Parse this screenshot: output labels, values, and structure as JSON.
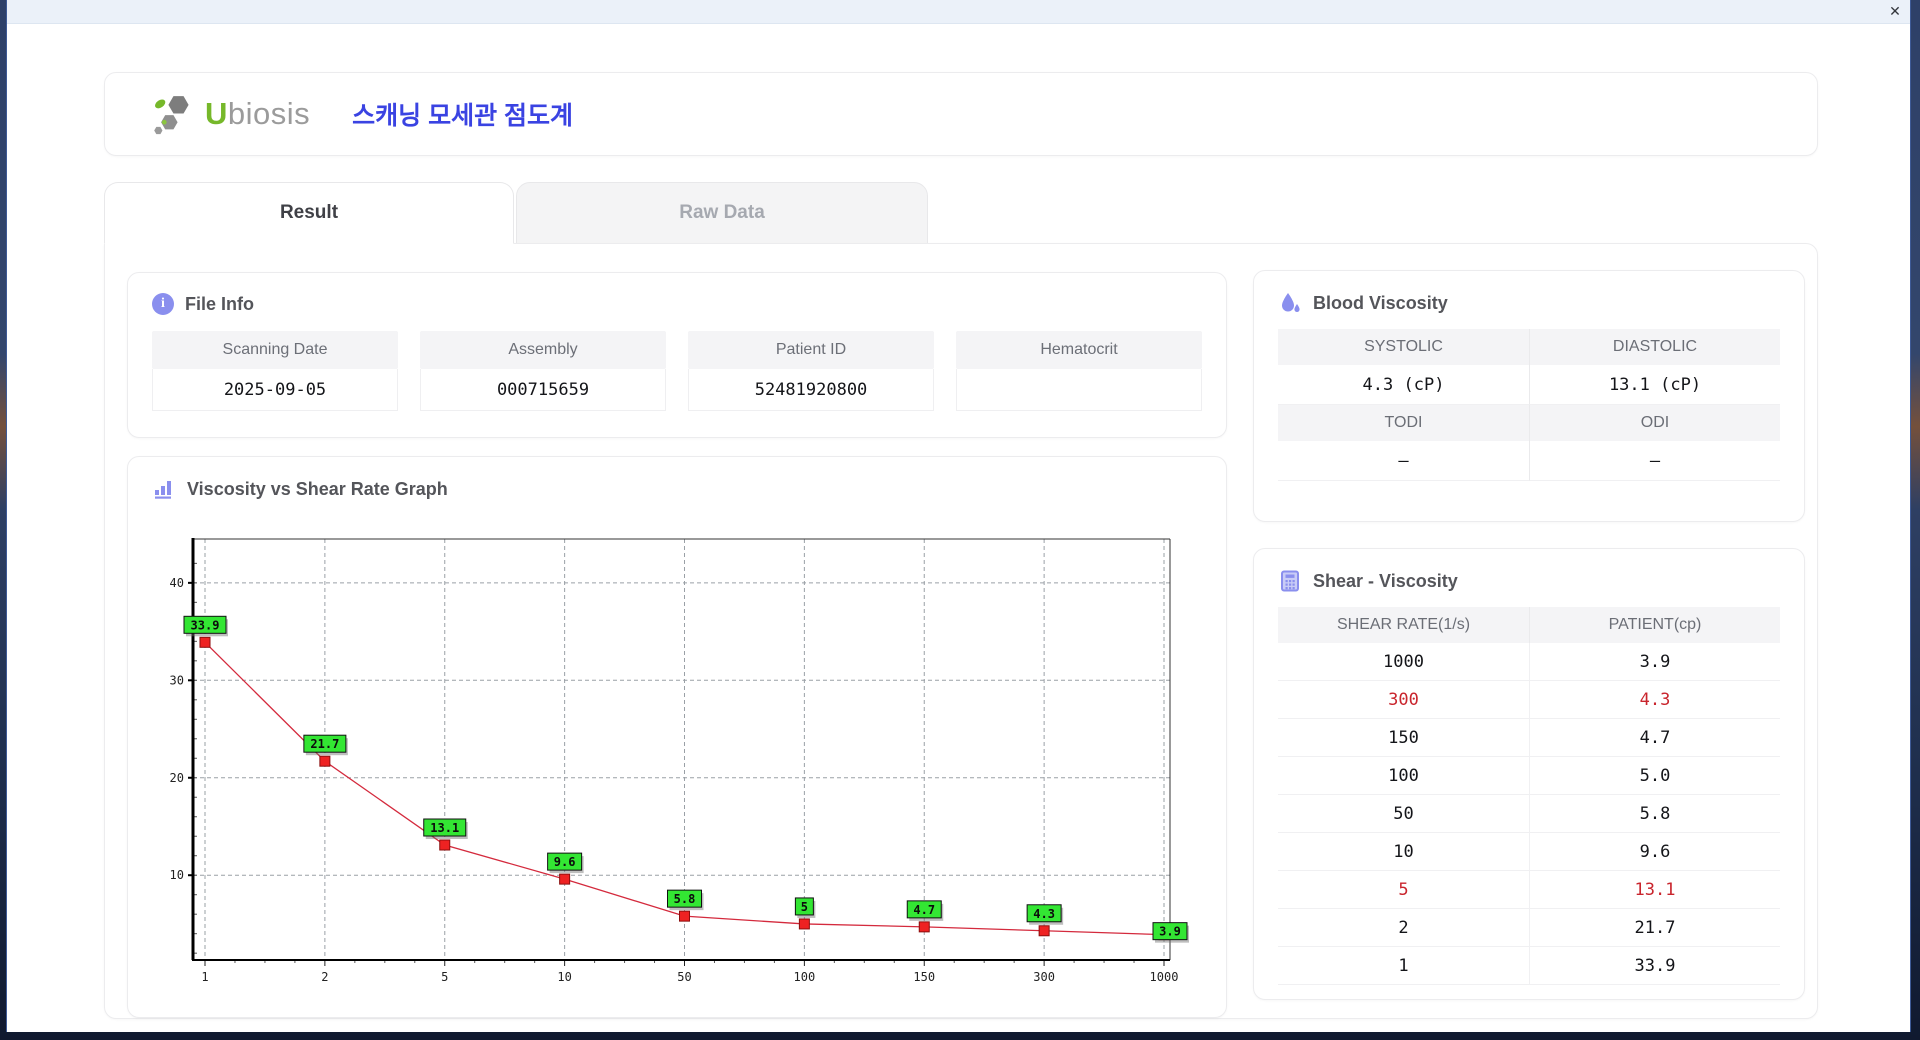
{
  "window": {
    "close_label": "✕"
  },
  "header": {
    "logo_text_u": "U",
    "logo_text_rest": "biosis",
    "app_title": "스캐닝 모세관 점도계"
  },
  "tabs": [
    {
      "label": "Result",
      "active": true
    },
    {
      "label": "Raw Data",
      "active": false
    }
  ],
  "file_info": {
    "title": "File Info",
    "fields": [
      {
        "label": "Scanning Date",
        "value": "2025-09-05"
      },
      {
        "label": "Assembly",
        "value": "000715659"
      },
      {
        "label": "Patient ID",
        "value": "52481920800"
      },
      {
        "label": "Hematocrit",
        "value": ""
      }
    ]
  },
  "blood_viscosity": {
    "title": "Blood Viscosity",
    "metrics": [
      {
        "label": "SYSTOLIC",
        "value": "4.3 (cP)"
      },
      {
        "label": "DIASTOLIC",
        "value": "13.1 (cP)"
      },
      {
        "label": "TODI",
        "value": "–"
      },
      {
        "label": "ODI",
        "value": "–"
      }
    ]
  },
  "shear_viscosity": {
    "title": "Shear - Viscosity",
    "headers": [
      "SHEAR RATE(1/s)",
      "PATIENT(cp)"
    ],
    "rows": [
      {
        "shear_rate": "1000",
        "patient": "3.9",
        "highlight": false
      },
      {
        "shear_rate": "300",
        "patient": "4.3",
        "highlight": true
      },
      {
        "shear_rate": "150",
        "patient": "4.7",
        "highlight": false
      },
      {
        "shear_rate": "100",
        "patient": "5.0",
        "highlight": false
      },
      {
        "shear_rate": "50",
        "patient": "5.8",
        "highlight": false
      },
      {
        "shear_rate": "10",
        "patient": "9.6",
        "highlight": false
      },
      {
        "shear_rate": "5",
        "patient": "13.1",
        "highlight": true
      },
      {
        "shear_rate": "2",
        "patient": "21.7",
        "highlight": false
      },
      {
        "shear_rate": "1",
        "patient": "33.9",
        "highlight": false
      }
    ]
  },
  "graph": {
    "title": "Viscosity vs Shear Rate Graph"
  },
  "chart_data": {
    "type": "line",
    "title": "Viscosity vs Shear Rate Graph",
    "x": [
      1,
      2,
      5,
      10,
      50,
      100,
      150,
      300,
      1000
    ],
    "x_tick_labels": [
      "1",
      "2",
      "5",
      "10",
      "50",
      "100",
      "150",
      "300",
      "1000"
    ],
    "series": [
      {
        "name": "PATIENT(cp)",
        "values": [
          33.9,
          21.7,
          13.1,
          9.6,
          5.8,
          5.0,
          4.7,
          4.3,
          3.9
        ]
      }
    ],
    "point_labels": [
      "33.9",
      "21.7",
      "13.1",
      "9.6",
      "5.8",
      "5",
      "4.7",
      "4.3",
      "3.9"
    ],
    "xlabel": "",
    "ylabel": "",
    "y_ticks": [
      10,
      20,
      30,
      40
    ],
    "ylim": [
      1.3,
      44.5
    ],
    "x_scale": "categorical-even-spacing",
    "grid": "dashed",
    "legend": "none",
    "line_color": "#d42a3d",
    "marker_color": "#ee2222",
    "label_bg": "#33e633"
  },
  "colors": {
    "accent_purple": "#8a8fee",
    "title_blue": "#3a43e2",
    "logo_green": "#76b82a",
    "highlight_red": "#c9252d",
    "header_cell_bg": "#f4f4f6"
  }
}
